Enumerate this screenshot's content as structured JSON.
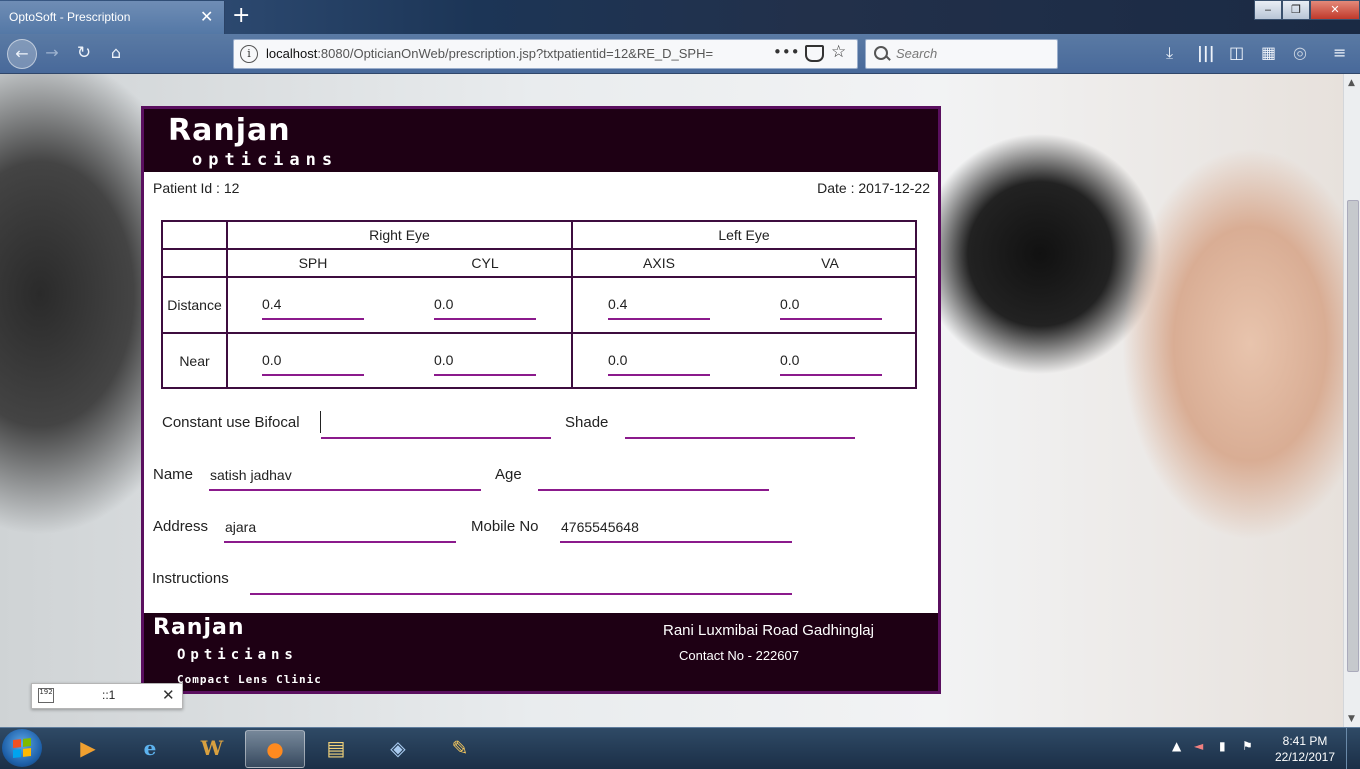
{
  "browser": {
    "tab_title": "OptoSoft - Prescription",
    "tab_close": "✕",
    "new_tab": "+",
    "url_host": "localhost",
    "url_path": ":8080/OpticianOnWeb/prescription.jsp?txtpatientid=12&RE_D_SPH=",
    "url_more": "•••",
    "search_placeholder": "Search",
    "window_min": "‒",
    "window_max": "❐",
    "window_close": "✕"
  },
  "header": {
    "brand": "Ranjan",
    "subtitle": "opticians"
  },
  "patient": {
    "id_label": "Patient Id : 12",
    "date_label": "Date : 2017-12-22"
  },
  "rx_table": {
    "right_eye": "Right Eye",
    "left_eye": "Left Eye",
    "columns": [
      "SPH",
      "CYL",
      "AXIS",
      "VA"
    ],
    "rows": [
      {
        "label": "Distance",
        "values": [
          "0.4",
          "0.0",
          "0.4",
          "0.0"
        ]
      },
      {
        "label": "Near",
        "values": [
          "0.0",
          "0.0",
          "0.0",
          "0.0"
        ]
      }
    ]
  },
  "form": {
    "bifocal_label": "Constant use Bifocal",
    "bifocal_value": "",
    "shade_label": "Shade",
    "shade_value": "",
    "name_label": "Name",
    "name_value": "satish jadhav",
    "age_label": "Age",
    "age_value": "",
    "address_label": "Address",
    "address_value": "ajara",
    "mobile_label": "Mobile No",
    "mobile_value": "4765545648",
    "instructions_label": "Instructions",
    "instructions_value": ""
  },
  "footer": {
    "brand": "Ranjan",
    "subtitle": "Opticians",
    "tagline": "Compact Lens Clinic",
    "address": "Rani Luxmibai Road Gadhinglaj",
    "contact": "Contact No - 222607"
  },
  "popup": {
    "text": "::1",
    "close": "✕"
  },
  "taskbar": {
    "time": "8:41 PM",
    "date": "22/12/2017",
    "apps": [
      "media-player-icon",
      "internet-explorer-icon",
      "word-icon",
      "firefox-icon",
      "file-explorer-icon",
      "virtualbox-icon",
      "paint-icon"
    ]
  },
  "colors": {
    "header_bg": "#1e0014",
    "card_border": "#5a0f5f",
    "underline": "#8b1a8c"
  }
}
